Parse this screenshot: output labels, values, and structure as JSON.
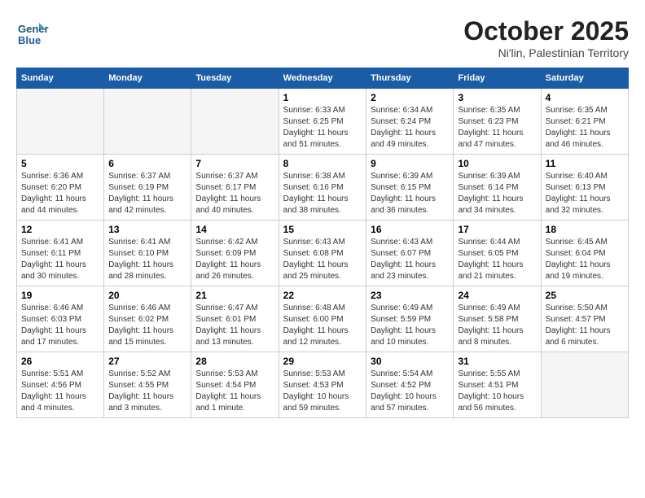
{
  "header": {
    "logo_text1": "General",
    "logo_text2": "Blue",
    "month_year": "October 2025",
    "location": "Ni'lin, Palestinian Territory"
  },
  "weekdays": [
    "Sunday",
    "Monday",
    "Tuesday",
    "Wednesday",
    "Thursday",
    "Friday",
    "Saturday"
  ],
  "weeks": [
    [
      {
        "day": "",
        "sunrise": "",
        "sunset": "",
        "daylight": "",
        "empty": true
      },
      {
        "day": "",
        "sunrise": "",
        "sunset": "",
        "daylight": "",
        "empty": true
      },
      {
        "day": "",
        "sunrise": "",
        "sunset": "",
        "daylight": "",
        "empty": true
      },
      {
        "day": "1",
        "sunrise": "Sunrise: 6:33 AM",
        "sunset": "Sunset: 6:25 PM",
        "daylight": "Daylight: 11 hours and 51 minutes."
      },
      {
        "day": "2",
        "sunrise": "Sunrise: 6:34 AM",
        "sunset": "Sunset: 6:24 PM",
        "daylight": "Daylight: 11 hours and 49 minutes."
      },
      {
        "day": "3",
        "sunrise": "Sunrise: 6:35 AM",
        "sunset": "Sunset: 6:23 PM",
        "daylight": "Daylight: 11 hours and 47 minutes."
      },
      {
        "day": "4",
        "sunrise": "Sunrise: 6:35 AM",
        "sunset": "Sunset: 6:21 PM",
        "daylight": "Daylight: 11 hours and 46 minutes."
      }
    ],
    [
      {
        "day": "5",
        "sunrise": "Sunrise: 6:36 AM",
        "sunset": "Sunset: 6:20 PM",
        "daylight": "Daylight: 11 hours and 44 minutes."
      },
      {
        "day": "6",
        "sunrise": "Sunrise: 6:37 AM",
        "sunset": "Sunset: 6:19 PM",
        "daylight": "Daylight: 11 hours and 42 minutes."
      },
      {
        "day": "7",
        "sunrise": "Sunrise: 6:37 AM",
        "sunset": "Sunset: 6:17 PM",
        "daylight": "Daylight: 11 hours and 40 minutes."
      },
      {
        "day": "8",
        "sunrise": "Sunrise: 6:38 AM",
        "sunset": "Sunset: 6:16 PM",
        "daylight": "Daylight: 11 hours and 38 minutes."
      },
      {
        "day": "9",
        "sunrise": "Sunrise: 6:39 AM",
        "sunset": "Sunset: 6:15 PM",
        "daylight": "Daylight: 11 hours and 36 minutes."
      },
      {
        "day": "10",
        "sunrise": "Sunrise: 6:39 AM",
        "sunset": "Sunset: 6:14 PM",
        "daylight": "Daylight: 11 hours and 34 minutes."
      },
      {
        "day": "11",
        "sunrise": "Sunrise: 6:40 AM",
        "sunset": "Sunset: 6:13 PM",
        "daylight": "Daylight: 11 hours and 32 minutes."
      }
    ],
    [
      {
        "day": "12",
        "sunrise": "Sunrise: 6:41 AM",
        "sunset": "Sunset: 6:11 PM",
        "daylight": "Daylight: 11 hours and 30 minutes."
      },
      {
        "day": "13",
        "sunrise": "Sunrise: 6:41 AM",
        "sunset": "Sunset: 6:10 PM",
        "daylight": "Daylight: 11 hours and 28 minutes."
      },
      {
        "day": "14",
        "sunrise": "Sunrise: 6:42 AM",
        "sunset": "Sunset: 6:09 PM",
        "daylight": "Daylight: 11 hours and 26 minutes."
      },
      {
        "day": "15",
        "sunrise": "Sunrise: 6:43 AM",
        "sunset": "Sunset: 6:08 PM",
        "daylight": "Daylight: 11 hours and 25 minutes."
      },
      {
        "day": "16",
        "sunrise": "Sunrise: 6:43 AM",
        "sunset": "Sunset: 6:07 PM",
        "daylight": "Daylight: 11 hours and 23 minutes."
      },
      {
        "day": "17",
        "sunrise": "Sunrise: 6:44 AM",
        "sunset": "Sunset: 6:05 PM",
        "daylight": "Daylight: 11 hours and 21 minutes."
      },
      {
        "day": "18",
        "sunrise": "Sunrise: 6:45 AM",
        "sunset": "Sunset: 6:04 PM",
        "daylight": "Daylight: 11 hours and 19 minutes."
      }
    ],
    [
      {
        "day": "19",
        "sunrise": "Sunrise: 6:46 AM",
        "sunset": "Sunset: 6:03 PM",
        "daylight": "Daylight: 11 hours and 17 minutes."
      },
      {
        "day": "20",
        "sunrise": "Sunrise: 6:46 AM",
        "sunset": "Sunset: 6:02 PM",
        "daylight": "Daylight: 11 hours and 15 minutes."
      },
      {
        "day": "21",
        "sunrise": "Sunrise: 6:47 AM",
        "sunset": "Sunset: 6:01 PM",
        "daylight": "Daylight: 11 hours and 13 minutes."
      },
      {
        "day": "22",
        "sunrise": "Sunrise: 6:48 AM",
        "sunset": "Sunset: 6:00 PM",
        "daylight": "Daylight: 11 hours and 12 minutes."
      },
      {
        "day": "23",
        "sunrise": "Sunrise: 6:49 AM",
        "sunset": "Sunset: 5:59 PM",
        "daylight": "Daylight: 11 hours and 10 minutes."
      },
      {
        "day": "24",
        "sunrise": "Sunrise: 6:49 AM",
        "sunset": "Sunset: 5:58 PM",
        "daylight": "Daylight: 11 hours and 8 minutes."
      },
      {
        "day": "25",
        "sunrise": "Sunrise: 5:50 AM",
        "sunset": "Sunset: 4:57 PM",
        "daylight": "Daylight: 11 hours and 6 minutes."
      }
    ],
    [
      {
        "day": "26",
        "sunrise": "Sunrise: 5:51 AM",
        "sunset": "Sunset: 4:56 PM",
        "daylight": "Daylight: 11 hours and 4 minutes."
      },
      {
        "day": "27",
        "sunrise": "Sunrise: 5:52 AM",
        "sunset": "Sunset: 4:55 PM",
        "daylight": "Daylight: 11 hours and 3 minutes."
      },
      {
        "day": "28",
        "sunrise": "Sunrise: 5:53 AM",
        "sunset": "Sunset: 4:54 PM",
        "daylight": "Daylight: 11 hours and 1 minute."
      },
      {
        "day": "29",
        "sunrise": "Sunrise: 5:53 AM",
        "sunset": "Sunset: 4:53 PM",
        "daylight": "Daylight: 10 hours and 59 minutes."
      },
      {
        "day": "30",
        "sunrise": "Sunrise: 5:54 AM",
        "sunset": "Sunset: 4:52 PM",
        "daylight": "Daylight: 10 hours and 57 minutes."
      },
      {
        "day": "31",
        "sunrise": "Sunrise: 5:55 AM",
        "sunset": "Sunset: 4:51 PM",
        "daylight": "Daylight: 10 hours and 56 minutes."
      },
      {
        "day": "",
        "sunrise": "",
        "sunset": "",
        "daylight": "",
        "empty": true
      }
    ]
  ]
}
